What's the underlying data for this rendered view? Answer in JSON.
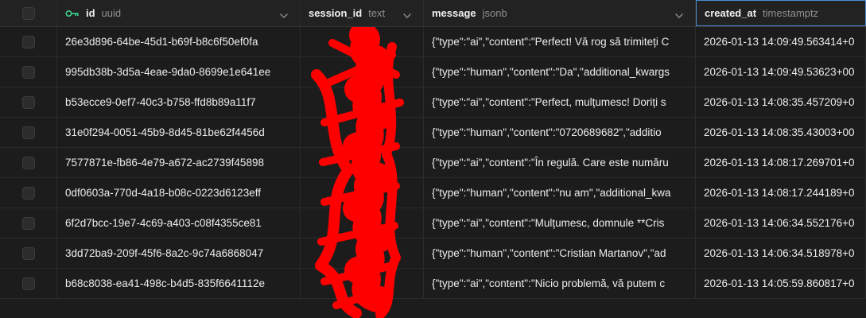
{
  "header": {
    "columns": [
      {
        "name": "id",
        "type": "uuid",
        "icon": "key-icon"
      },
      {
        "name": "session_id",
        "type": "text"
      },
      {
        "name": "message",
        "type": "jsonb"
      },
      {
        "name": "created_at",
        "type": "timestamptz"
      }
    ]
  },
  "rows": [
    {
      "id": "26e3d896-64be-45d1-b69f-b8c6f50ef0fa",
      "message": "{\"type\":\"ai\",\"content\":\"Perfect! Vă rog să trimiteți C",
      "created_at": "2026-01-13 14:09:49.563414+0"
    },
    {
      "id": "995db38b-3d5a-4eae-9da0-8699e1e641ee",
      "message": "{\"type\":\"human\",\"content\":\"Da\",\"additional_kwargs",
      "created_at": "2026-01-13 14:09:49.53623+00"
    },
    {
      "id": "b53ecce9-0ef7-40c3-b758-ffd8b89a11f7",
      "message": "{\"type\":\"ai\",\"content\":\"Perfect, mulțumesc! Doriți s",
      "created_at": "2026-01-13 14:08:35.457209+0"
    },
    {
      "id": "31e0f294-0051-45b9-8d45-81be62f4456d",
      "message": "{\"type\":\"human\",\"content\":\"0720689682\",\"additio",
      "created_at": "2026-01-13 14:08:35.43003+00"
    },
    {
      "id": "7577871e-fb86-4e79-a672-ac2739f45898",
      "message": "{\"type\":\"ai\",\"content\":\"În regulă. Care este număru",
      "created_at": "2026-01-13 14:08:17.269701+0"
    },
    {
      "id": "0df0603a-770d-4a18-b08c-0223d6123eff",
      "message": "{\"type\":\"human\",\"content\":\"nu am\",\"additional_kwa",
      "created_at": "2026-01-13 14:08:17.244189+0"
    },
    {
      "id": "6f2d7bcc-19e7-4c69-a403-c08f4355ce81",
      "message": "{\"type\":\"ai\",\"content\":\"Mulțumesc, domnule **Cris",
      "created_at": "2026-01-13 14:06:34.552176+0"
    },
    {
      "id": "3dd72ba9-209f-45f6-8a2c-9c74a6868047",
      "message": "{\"type\":\"human\",\"content\":\"Cristian Martanov\",\"ad",
      "created_at": "2026-01-13 14:06:34.518978+0"
    },
    {
      "id": "b68c8038-ea41-498c-b4d5-835f6641112e",
      "message": "{\"type\":\"ai\",\"content\":\"Nicio problemă, vă putem c",
      "created_at": "2026-01-13 14:05:59.860817+0"
    }
  ],
  "colors": {
    "accent": "#4a8fd6",
    "key": "#3ecf8e",
    "redaction": "#ff0000"
  }
}
